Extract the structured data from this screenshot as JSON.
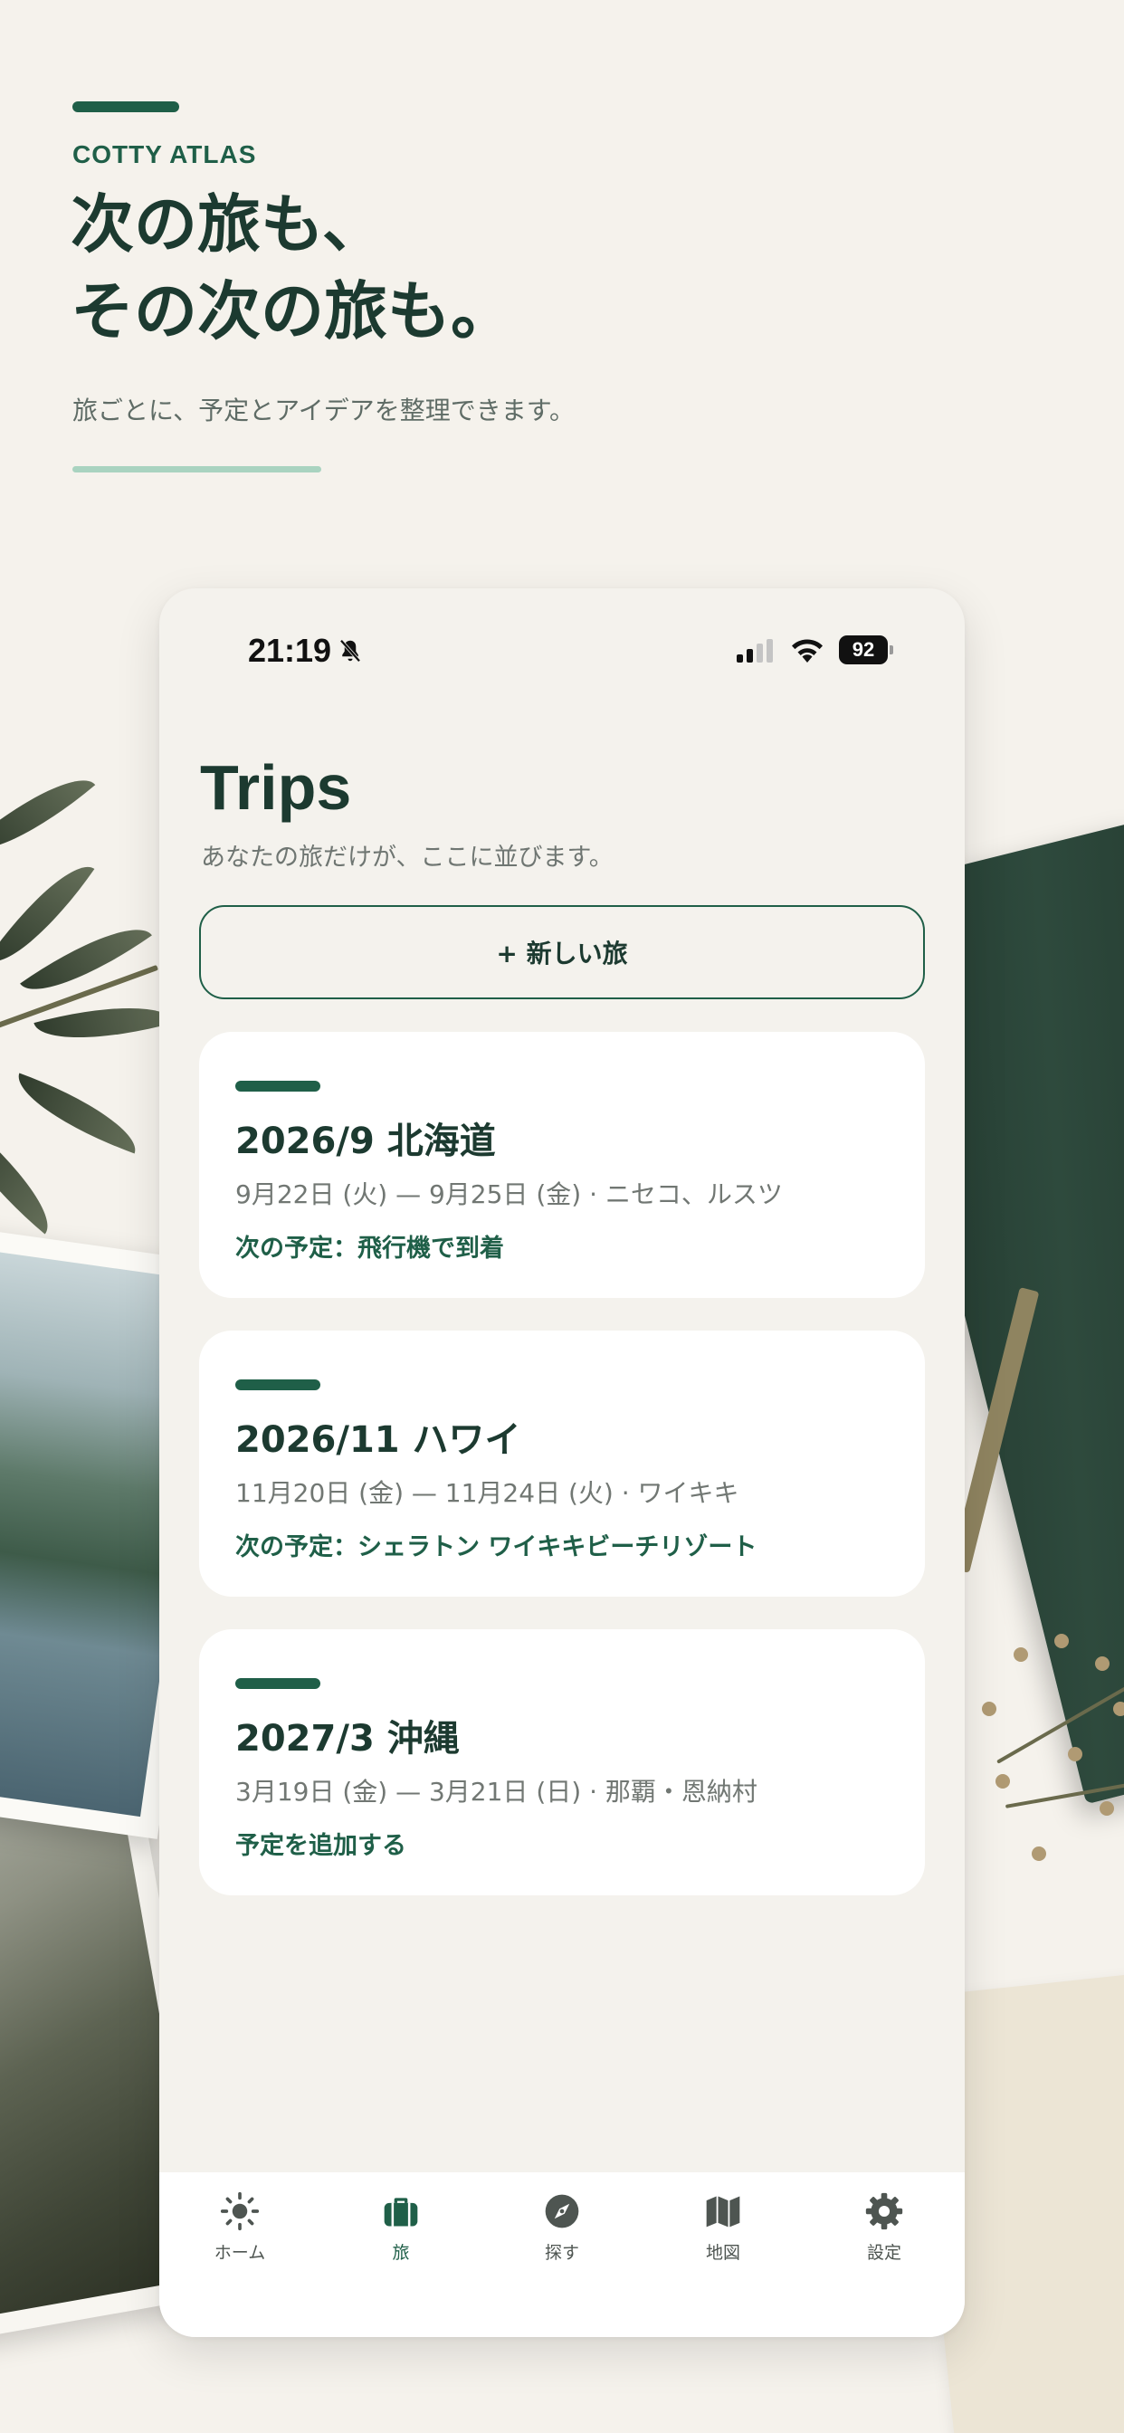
{
  "hero": {
    "brand": "COTTY ATLAS",
    "headline_line1": "次の旅も、",
    "headline_line2": "その次の旅も。",
    "subline": "旅ごとに、予定とアイデアを整理できます。"
  },
  "status_bar": {
    "time": "21:19",
    "battery": "92"
  },
  "screen": {
    "title": "Trips",
    "subtitle": "あなたの旅だけが、ここに並びます。",
    "new_trip_label": "+ 新しい旅"
  },
  "trips": [
    {
      "title": "2026/9 北海道",
      "meta": "9月22日 (火) — 9月25日 (金) · ニセコ、ルスツ",
      "next": "次の予定：飛行機で到着"
    },
    {
      "title": "2026/11 ハワイ",
      "meta": "11月20日 (金) — 11月24日 (火) · ワイキキ",
      "next": "次の予定：シェラトン ワイキキビーチリゾート"
    },
    {
      "title": "2027/3 沖縄",
      "meta": "3月19日 (金) — 3月21日 (日) · 那覇・恩納村",
      "next": "予定を追加する"
    }
  ],
  "tabs": [
    {
      "label": "ホーム",
      "icon": "sun-icon",
      "active": false
    },
    {
      "label": "旅",
      "icon": "suitcase-icon",
      "active": true
    },
    {
      "label": "探す",
      "icon": "compass-icon",
      "active": false
    },
    {
      "label": "地図",
      "icon": "map-icon",
      "active": false
    },
    {
      "label": "設定",
      "icon": "gear-icon",
      "active": false
    }
  ],
  "colors": {
    "accent": "#1f5f48",
    "heading": "#1c3a30",
    "page_bg": "#f5f2ec",
    "card_bg": "#ffffff"
  }
}
